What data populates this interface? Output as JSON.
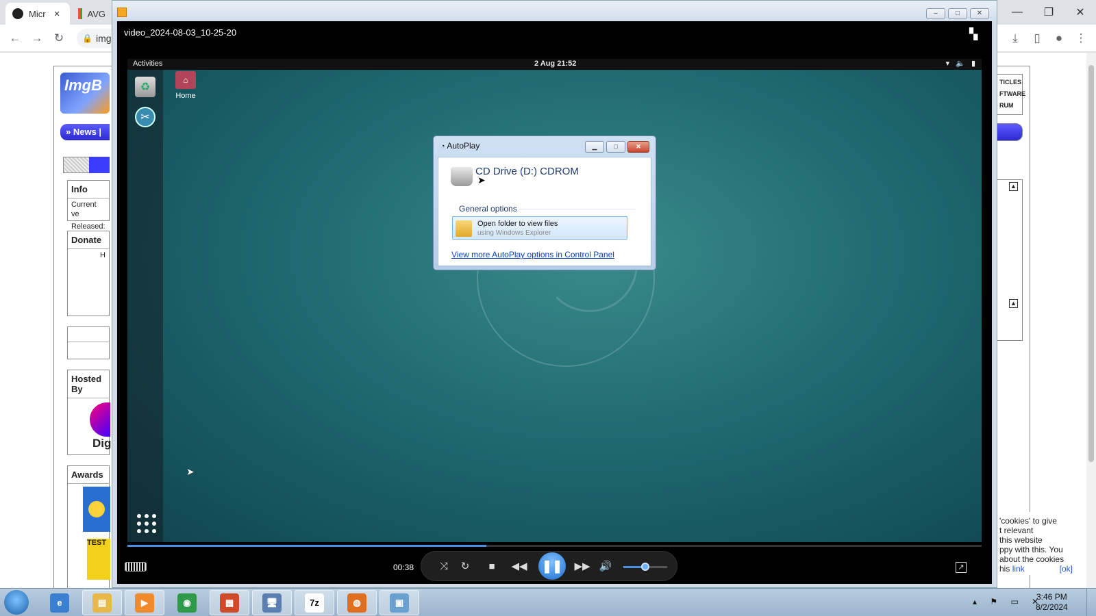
{
  "browser": {
    "tabs": [
      {
        "label": "Micr",
        "icon": "github-icon"
      },
      {
        "label": "AVG",
        "icon": "avg-icon"
      }
    ],
    "tab_close": "✕",
    "address_prefix": "img",
    "window_controls": [
      "—",
      "❐",
      "✕"
    ]
  },
  "site": {
    "logo_text": "ImgB",
    "nav_text": "» News | D",
    "boxes": [
      {
        "title": "Info",
        "lines": [
          "Current ve",
          "Released:"
        ]
      },
      {
        "title": "Donate",
        "lines": [
          "H"
        ]
      },
      {
        "title": "",
        "lines": []
      },
      {
        "title": "Hosted By",
        "lines": [
          "Dig"
        ]
      },
      {
        "title": "Awards",
        "lines": [
          "TEST"
        ]
      }
    ],
    "right_nav": [
      "TICLES",
      "FTWARE",
      "RUM"
    ],
    "cookie_lines": [
      "'cookies' to give",
      "t relevant",
      "this website",
      "ppy with this. You",
      "about the cookies"
    ],
    "cookie_link_prefix": "his",
    "cookie_link": "link",
    "cookie_ok": "[ok]"
  },
  "player": {
    "window_buttons": [
      "–",
      "□",
      "✕"
    ],
    "video_name": "video_2024-08-03_10-25-20",
    "timecode": "00:38",
    "progress": 0.42,
    "volume": 0.5,
    "accent": "#4a8fe6"
  },
  "desktop": {
    "activities": "Activities",
    "clock": "2 Aug 21:52",
    "tray": "▾ 🔈 ▮",
    "home_label": "Home"
  },
  "autoplay": {
    "title": "AutoPlay",
    "drive": "CD Drive (D:) CDROM",
    "general_options": "General options",
    "option_title": "Open folder to view files",
    "option_subtitle": "using Windows Explorer",
    "link": "View more AutoPlay options in Control Panel"
  },
  "taskbar": {
    "apps": [
      {
        "name": "ie-icon",
        "glyph": "e"
      },
      {
        "name": "explorer-icon",
        "glyph": "▤"
      },
      {
        "name": "media-player-icon",
        "glyph": "▶"
      },
      {
        "name": "chrome-icon",
        "glyph": "◉"
      },
      {
        "name": "avg-icon",
        "glyph": "▦"
      },
      {
        "name": "computer-icon",
        "glyph": "🖥"
      },
      {
        "name": "7zip-icon",
        "glyph": "7z"
      },
      {
        "name": "imgburn-icon",
        "glyph": "◍"
      },
      {
        "name": "control-panel-icon",
        "glyph": "▣"
      }
    ],
    "tray": "▴ ⚑ ▭ ✕",
    "time": "3:46 PM",
    "date": "8/2/2024"
  }
}
